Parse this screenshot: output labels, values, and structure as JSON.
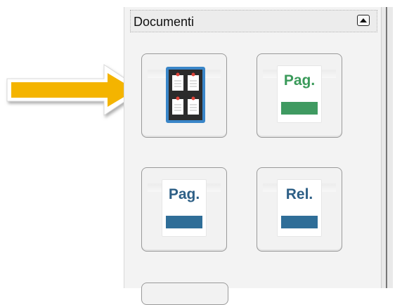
{
  "panel": {
    "title": "Documenti"
  },
  "tiles": [
    {
      "name": "noticeboard-tile",
      "icon": "noticeboard-icon",
      "label": "",
      "bar_color": ""
    },
    {
      "name": "pag-green-tile",
      "icon": "document-icon",
      "label": "Pag.",
      "label_color": "#3a9a5a",
      "bar_color": "#3f9a61"
    },
    {
      "name": "pag-blue-tile",
      "icon": "document-icon",
      "label": "Pag.",
      "label_color": "#2d5f86",
      "bar_color": "#2f6e98"
    },
    {
      "name": "rel-blue-tile",
      "icon": "document-icon",
      "label": "Rel.",
      "label_color": "#2d5f86",
      "bar_color": "#2f6e98"
    }
  ],
  "colors": {
    "arrow": "#f4b400",
    "board": "#2b2b2b",
    "board_frame": "#3a86c8"
  }
}
